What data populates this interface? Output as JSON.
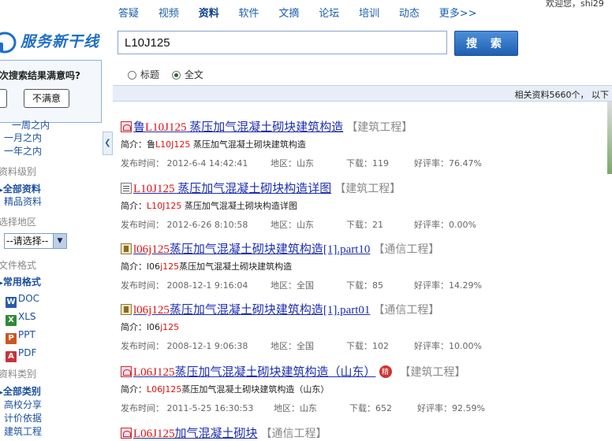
{
  "header": {
    "welcome": "欢迎您，shi29",
    "nav": [
      {
        "label": "答疑",
        "active": false
      },
      {
        "label": "视频",
        "active": false
      },
      {
        "label": "资料",
        "active": true
      },
      {
        "label": "软件",
        "active": false
      },
      {
        "label": "文摘",
        "active": false
      },
      {
        "label": "论坛",
        "active": false
      },
      {
        "label": "培训",
        "active": false
      },
      {
        "label": "动态",
        "active": false
      },
      {
        "label": "更多>>",
        "active": false
      }
    ],
    "logo_text": "服务新干线"
  },
  "search": {
    "value": "L10J125",
    "button": "搜 索",
    "scope_title": "标题",
    "scope_full": "全文",
    "scope_selected": "全文"
  },
  "survey": {
    "question": "次搜索结果满意吗?",
    "unsatisfied": "不满意"
  },
  "filters": {
    "time": [
      "一周之内",
      "一月之内",
      "一年之内"
    ],
    "level_head": "资料级别",
    "level_all": "全部资料",
    "level_fine": "精品资料",
    "region_head": "选择地区",
    "region_select": "--请选择--",
    "format_head": "文件格式",
    "format_common": "常用格式",
    "formats": [
      "DOC",
      "XLS",
      "PPT",
      "PDF"
    ],
    "category_head": "资料类别",
    "category_all": "全部类别",
    "categories": [
      "高校分享",
      "计价依据",
      "建筑工程"
    ]
  },
  "results_info": {
    "count_text": "相关资料5660个， 以下"
  },
  "results": [
    {
      "icon": "pdf",
      "pre": "鲁",
      "hl": "L10J125",
      "post": " 蒸压加气混凝土砌块建筑构造",
      "category": "【建筑工程】",
      "summary_label": "简介：",
      "summary_pre": "鲁",
      "summary_hl": "L10J125",
      "summary_post": " 蒸压加气混凝土砌块建筑构造",
      "date": "发布时间： 2012-6-4 14:42:41",
      "region": "地区：山东",
      "downloads": "下载：119",
      "rating": "好评率：76.47%"
    },
    {
      "icon": "txt",
      "pre": "",
      "hl": "L10J125",
      "post": " 蒸压加气混凝土砌块构造详图",
      "category": "【建筑工程】",
      "summary_label": "简介：",
      "summary_pre": "",
      "summary_hl": "L10J125",
      "summary_post": " 蒸压加气混凝土砌块构造详图",
      "date": "发布时间： 2012-6-26 8:10:58",
      "region": "地区：山东",
      "downloads": "下载：21",
      "rating": "好评率：0.00%"
    },
    {
      "icon": "rar",
      "pre": "",
      "hl": "l06j125",
      "post": "蒸压加气混凝土砌块建筑构造[1].part10",
      "category": "【通信工程】",
      "summary_label": "简介：",
      "summary_pre": "l06",
      "summary_hl": "j125",
      "summary_post": "蒸压加气混凝土砌块建筑构造",
      "date": "发布时间： 2008-12-1 9:16:04",
      "region": "地区：全国",
      "downloads": "下载：85",
      "rating": "好评率：14.29%"
    },
    {
      "icon": "rar",
      "pre": "",
      "hl": "l06j125",
      "post": "蒸压加气混凝土砌块建筑构造[1].part01",
      "category": "【通信工程】",
      "summary_label": "简介：",
      "summary_pre": "l06",
      "summary_hl": "j125",
      "summary_post": "",
      "date": "发布时间： 2008-12-1 9:06:38",
      "region": "地区：全国",
      "downloads": "下载：102",
      "rating": "好评率：10.00%"
    },
    {
      "icon": "pdf",
      "pre": "",
      "hl": "L06J125",
      "post": "蒸压加气混凝土砌块建筑构造（山东）",
      "category": "【建筑工程】",
      "badge": "精",
      "summary_label": "简介：",
      "summary_pre": "",
      "summary_hl": "L06J125",
      "summary_post": "蒸压加气混凝土砌块建筑构造（山东）",
      "date": "发布时间： 2011-5-25 16:30:53",
      "region": "地区：山东",
      "downloads": "下载：652",
      "rating": "好评率：92.59%"
    },
    {
      "icon": "pdf",
      "pre": "",
      "hl": "L06J125",
      "post": "加气混凝土砌块",
      "category": "【通信工程】"
    }
  ]
}
